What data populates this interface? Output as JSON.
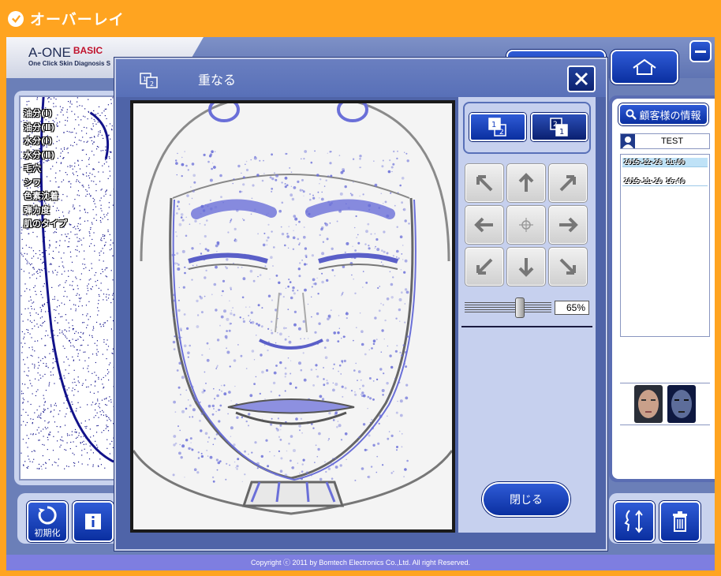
{
  "topbar": {
    "title": "オーバーレイ"
  },
  "app": {
    "logo_main": "A-ONE",
    "logo_badge": "BASIC",
    "logo_sub": "One Click Skin Diagnosis S"
  },
  "left_menu": [
    "油分(Ⅰ)",
    "油分(Ⅱ)",
    "水分(Ⅰ)",
    "水分(Ⅱ)",
    "毛穴",
    "シワ",
    "色素沈着",
    "弾力度",
    "肌のタイプ"
  ],
  "buttons": {
    "reset_label": "初期化"
  },
  "customer": {
    "info_label": "顧客様の情報",
    "name": "TEST",
    "dates": [
      "2015-12-28 11:09",
      "2015-11-20 16:40"
    ]
  },
  "footer": {
    "copyright": "Copyright ⓒ 2011 by Bomtech Electronics Co.,Ltd. All right Reserved."
  },
  "dialog": {
    "title": "重なる",
    "opacity": "65%",
    "opacity_value": 0.65,
    "close_label": "閉じる"
  },
  "colors": {
    "accent_orange": "#FFA420",
    "button_blue": "#1a43c2",
    "overlay_blue": "#6a6fd8"
  }
}
